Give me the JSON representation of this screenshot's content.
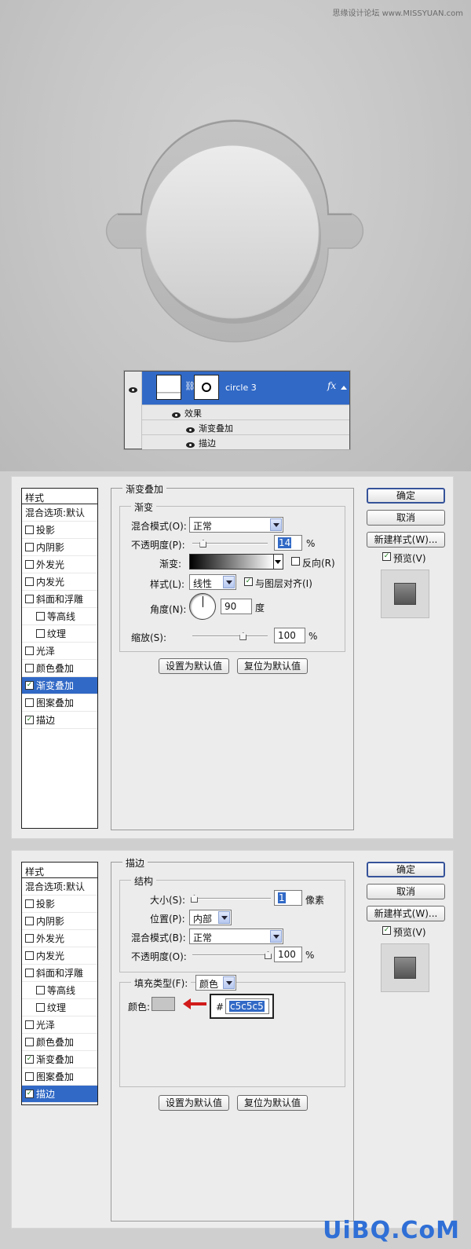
{
  "watermark_top": "思缘设计论坛 www.MISSYUAN.com",
  "watermark_bottom": "UiBQ.CoM",
  "layers_panel": {
    "layer_name": "circle 3",
    "fx_label": "fx",
    "effects_label": "效果",
    "effects": [
      "渐变叠加",
      "描边"
    ]
  },
  "style_list": {
    "header": "样式",
    "items": [
      {
        "label": "混合选项:默认",
        "checkbox": false
      },
      {
        "label": "投影",
        "checkbox": true
      },
      {
        "label": "内阴影",
        "checkbox": true
      },
      {
        "label": "外发光",
        "checkbox": true
      },
      {
        "label": "内发光",
        "checkbox": true
      },
      {
        "label": "斜面和浮雕",
        "checkbox": true
      },
      {
        "label": "等高线",
        "checkbox": true
      },
      {
        "label": "纹理",
        "checkbox": true
      },
      {
        "label": "光泽",
        "checkbox": true
      },
      {
        "label": "颜色叠加",
        "checkbox": true
      },
      {
        "label": "渐变叠加",
        "checkbox": true
      },
      {
        "label": "图案叠加",
        "checkbox": true
      },
      {
        "label": "描边",
        "checkbox": true
      }
    ]
  },
  "buttons": {
    "ok": "确定",
    "cancel": "取消",
    "new_style": "新建样式(W)...",
    "preview": "预览(V)",
    "set_default": "设置为默认值",
    "reset_default": "复位为默认值"
  },
  "gradient_overlay": {
    "title": "渐变叠加",
    "group": "渐变",
    "blend_mode_label": "混合模式(O):",
    "blend_mode": "正常",
    "opacity_label": "不透明度(P):",
    "opacity": "14",
    "percent": "%",
    "opacity_fraction": 0.14,
    "gradient_label": "渐变:",
    "reverse_label": "反向(R)",
    "style_label": "样式(L):",
    "style": "线性",
    "align_label": "与图层对齐(I)",
    "angle_label": "角度(N):",
    "angle": "90",
    "degree": "度",
    "scale_label": "缩放(S):",
    "scale": "100",
    "scale_fraction": 0.67
  },
  "stroke": {
    "title": "描边",
    "group": "结构",
    "size_label": "大小(S):",
    "size": "1",
    "size_unit": "像素",
    "position_label": "位置(P):",
    "position": "内部",
    "blend_mode_label": "混合模式(B):",
    "blend_mode": "正常",
    "opacity_label": "不透明度(O):",
    "opacity": "100",
    "percent": "%",
    "fill_type_label": "填充类型(F):",
    "fill_type": "颜色",
    "color_label": "颜色:",
    "hash": "#",
    "hex": "c5c5c5",
    "color": "#c5c5c5"
  },
  "colors": {
    "selection": "#3169c6",
    "arrow": "#d11a1a"
  }
}
